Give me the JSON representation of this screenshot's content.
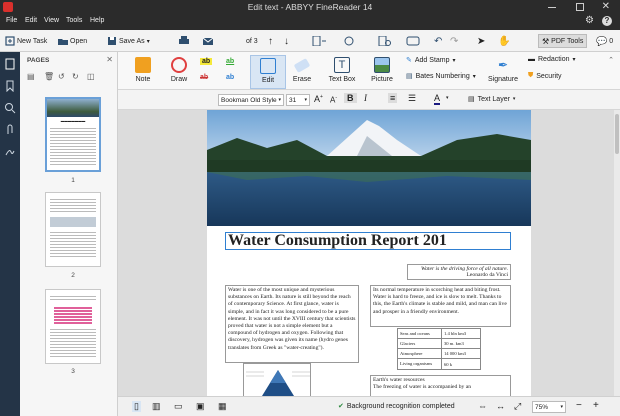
{
  "window": {
    "title": "Edit text - ABBYY FineReader 14"
  },
  "menu": [
    "File",
    "Edit",
    "View",
    "Tools",
    "Help"
  ],
  "toolbar": {
    "new_task": "New Task",
    "open": "Open",
    "save_as": "Save As",
    "page_current": "1",
    "page_total": "of 3",
    "pdf_tools": "PDF Tools",
    "comments_count": "0"
  },
  "pages_panel": {
    "title": "PAGES",
    "thumbnails": [
      "1",
      "2",
      "3"
    ]
  },
  "ribbon": {
    "note": "Note",
    "draw": "Draw",
    "edit": "Edit",
    "erase": "Erase",
    "text_box": "Text Box",
    "picture": "Picture",
    "add_stamp": "Add Stamp",
    "bates_numbering": "Bates Numbering",
    "signature": "Signature",
    "redaction": "Redaction",
    "security": "Security"
  },
  "format": {
    "font": "Bookman Old Style",
    "size": "31",
    "text_layer": "Text Layer"
  },
  "document": {
    "heading": "Water Consumption Report 201",
    "quote_line1": "Water is the driving force of all nature.",
    "quote_line2": "Leonardo da Vinci",
    "col1": "Water is one of the most unique and mysterious substances on Earth. Its nature is still beyond the reach of contemporary Science. At first glance, water is simple, and in fact it was long considered to be a pure element. It was not until the XVIII century that scientists proved that water is not a simple element but a compound of hydrogen and oxygen. Following that discovery, hydrogen was given its name (hydro genes translates from Greek as \"water-creating\").",
    "col2": "Its normal temperature in scorching heat and biting frost. Water is hard to freeze, and ice is slow to melt. Thanks to this, the Earth's climate is stable and mild, and man can live and prosper in a friendly environment.",
    "table": [
      [
        "Seas and oceans",
        "1.4 bln km3"
      ],
      [
        "Glaciers",
        "30 m. km3"
      ],
      [
        "Atmosphere",
        "14 000 km3"
      ],
      [
        "Living organisms",
        "60 k"
      ]
    ],
    "sub_heading": "Earth's water resources",
    "col2b": "The freezing of water is accompanied by an"
  },
  "status": {
    "recognition": "Background recognition completed",
    "zoom": "75%"
  },
  "colors": {
    "titlebar": "#2b2b2b",
    "rail": "#243447",
    "accent": "#2f7fd1",
    "note_orange": "#f0a020",
    "draw_red": "#e04040"
  }
}
